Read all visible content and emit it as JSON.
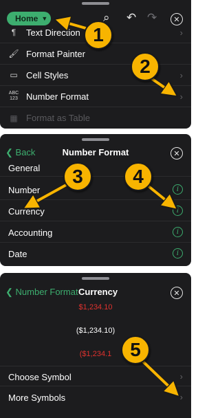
{
  "panel1": {
    "home_label": "Home",
    "chevron": "⌄",
    "toolbar_icons": [
      "search-icon",
      "undo-icon",
      "redo-icon",
      "close-icon"
    ],
    "items": [
      {
        "icon": "text-direction-icon",
        "glyph": "¶",
        "label": "Text Direction",
        "dim": false
      },
      {
        "icon": "format-painter-icon",
        "glyph": "⌨",
        "label": "Format Painter",
        "dim": false
      },
      {
        "icon": "cell-styles-icon",
        "glyph": "▭",
        "label": "Cell Styles",
        "dim": false
      },
      {
        "icon": "number-format-icon",
        "glyph": "ABC",
        "label": "Number Format",
        "dim": false
      },
      {
        "icon": "format-as-table-icon",
        "glyph": "▦",
        "label": "Format as Table",
        "dim": true
      }
    ]
  },
  "panel2": {
    "back_label": "Back",
    "title": "Number Format",
    "items": [
      "General",
      "Number",
      "Currency",
      "Accounting",
      "Date"
    ]
  },
  "panel3": {
    "back_label": "Number Format",
    "title": "Currency",
    "samples": [
      {
        "text": "$1,234.10",
        "color": "#e0322e"
      },
      {
        "text": "($1,234.10)",
        "color": "#ffffff"
      },
      {
        "text": "($1,234.1",
        "color": "#e0322e"
      }
    ],
    "options": [
      "Choose Symbol",
      "More Symbols"
    ]
  },
  "callouts": [
    "1",
    "2",
    "3",
    "4",
    "5"
  ],
  "colors": {
    "accent": "#3dae6f",
    "badge": "#f8b400",
    "negative": "#e0322e",
    "panel_bg": "#1c1c1e"
  }
}
